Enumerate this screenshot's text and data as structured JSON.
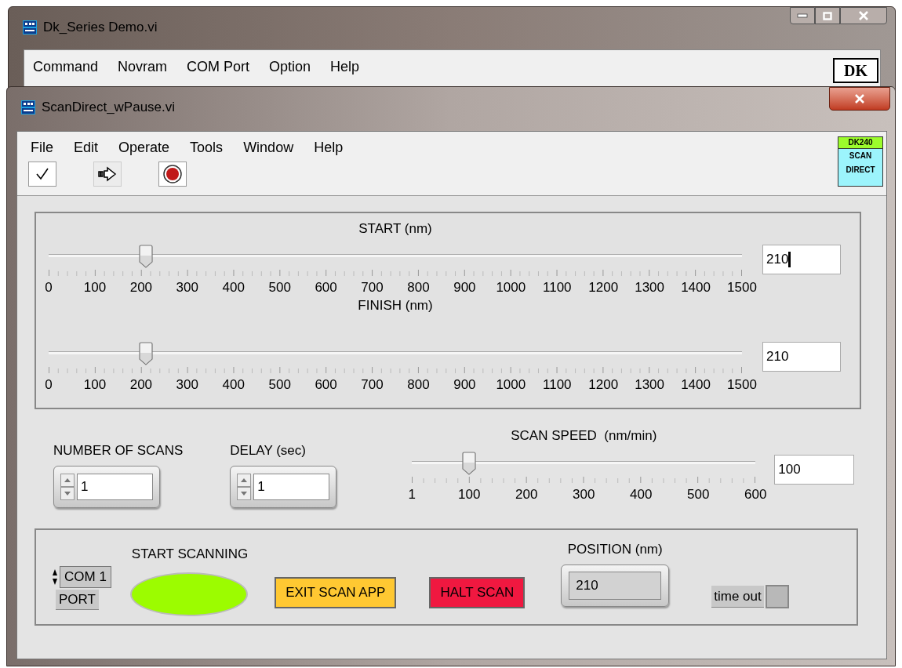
{
  "back_window": {
    "title": "Dk_Series Demo.vi",
    "menu": [
      "Command",
      "Novram",
      "COM Port",
      "Option",
      "Help"
    ],
    "logo": "DK"
  },
  "window": {
    "title": "ScanDirect_wPause.vi",
    "menu": [
      "File",
      "Edit",
      "Operate",
      "Tools",
      "Window",
      "Help"
    ],
    "logo": [
      "DK240",
      "SCAN",
      "DIRECT"
    ]
  },
  "range_panel": {
    "sliders": [
      {
        "label": "START (nm)",
        "level": 0.14,
        "value": "210",
        "focused": true,
        "ticks": [
          "0",
          "100",
          "200",
          "300",
          "400",
          "500",
          "600",
          "700",
          "800",
          "900",
          "1000",
          "1100",
          "1200",
          "1300",
          "1400",
          "1500"
        ]
      },
      {
        "label": "FINISH (nm)",
        "level": 0.14,
        "value": "210",
        "focused": false,
        "ticks": [
          "0",
          "100",
          "200",
          "300",
          "400",
          "500",
          "600",
          "700",
          "800",
          "900",
          "1000",
          "1100",
          "1200",
          "1300",
          "1400",
          "1500"
        ]
      }
    ]
  },
  "number_of_scans": {
    "label": "NUMBER OF SCANS",
    "value": "1"
  },
  "delay": {
    "label": "DELAY (sec)",
    "value": "1"
  },
  "scan_speed": {
    "label": "SCAN SPEED  (nm/min)",
    "level": 0.167,
    "value": "100",
    "ticks": [
      "1",
      "100",
      "200",
      "300",
      "400",
      "500",
      "600"
    ]
  },
  "port": {
    "value": "COM 1",
    "label": "PORT"
  },
  "start_scanning": {
    "label": "START SCANNING",
    "on": true
  },
  "buttons": [
    {
      "label": "EXIT SCAN APP",
      "kind": "exit"
    },
    {
      "label": "HALT SCAN",
      "kind": "halt"
    }
  ],
  "position": {
    "label": "POSITION (nm)",
    "value": "210"
  },
  "timeout": {
    "label": "time out",
    "on": false
  }
}
